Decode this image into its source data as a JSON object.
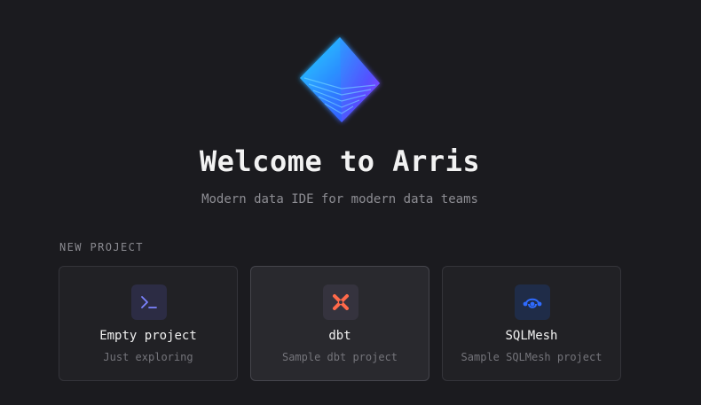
{
  "header": {
    "title": "Welcome to Arris",
    "subtitle": "Modern data IDE for modern data teams"
  },
  "new_project": {
    "section_label": "NEW PROJECT",
    "cards": [
      {
        "title": "Empty project",
        "description": "Just exploring",
        "icon": "terminal-icon",
        "accent": "#7c83ff"
      },
      {
        "title": "dbt",
        "description": "Sample dbt project",
        "icon": "dbt-icon",
        "accent": "#ff694a"
      },
      {
        "title": "SQLMesh",
        "description": "Sample SQLMesh project",
        "icon": "sqlmesh-icon",
        "accent": "#2f6bff"
      }
    ]
  },
  "logo": {
    "icon": "arris-logo-icon",
    "colors": [
      "#1ec8ff",
      "#3a63ff",
      "#a43cff"
    ]
  }
}
